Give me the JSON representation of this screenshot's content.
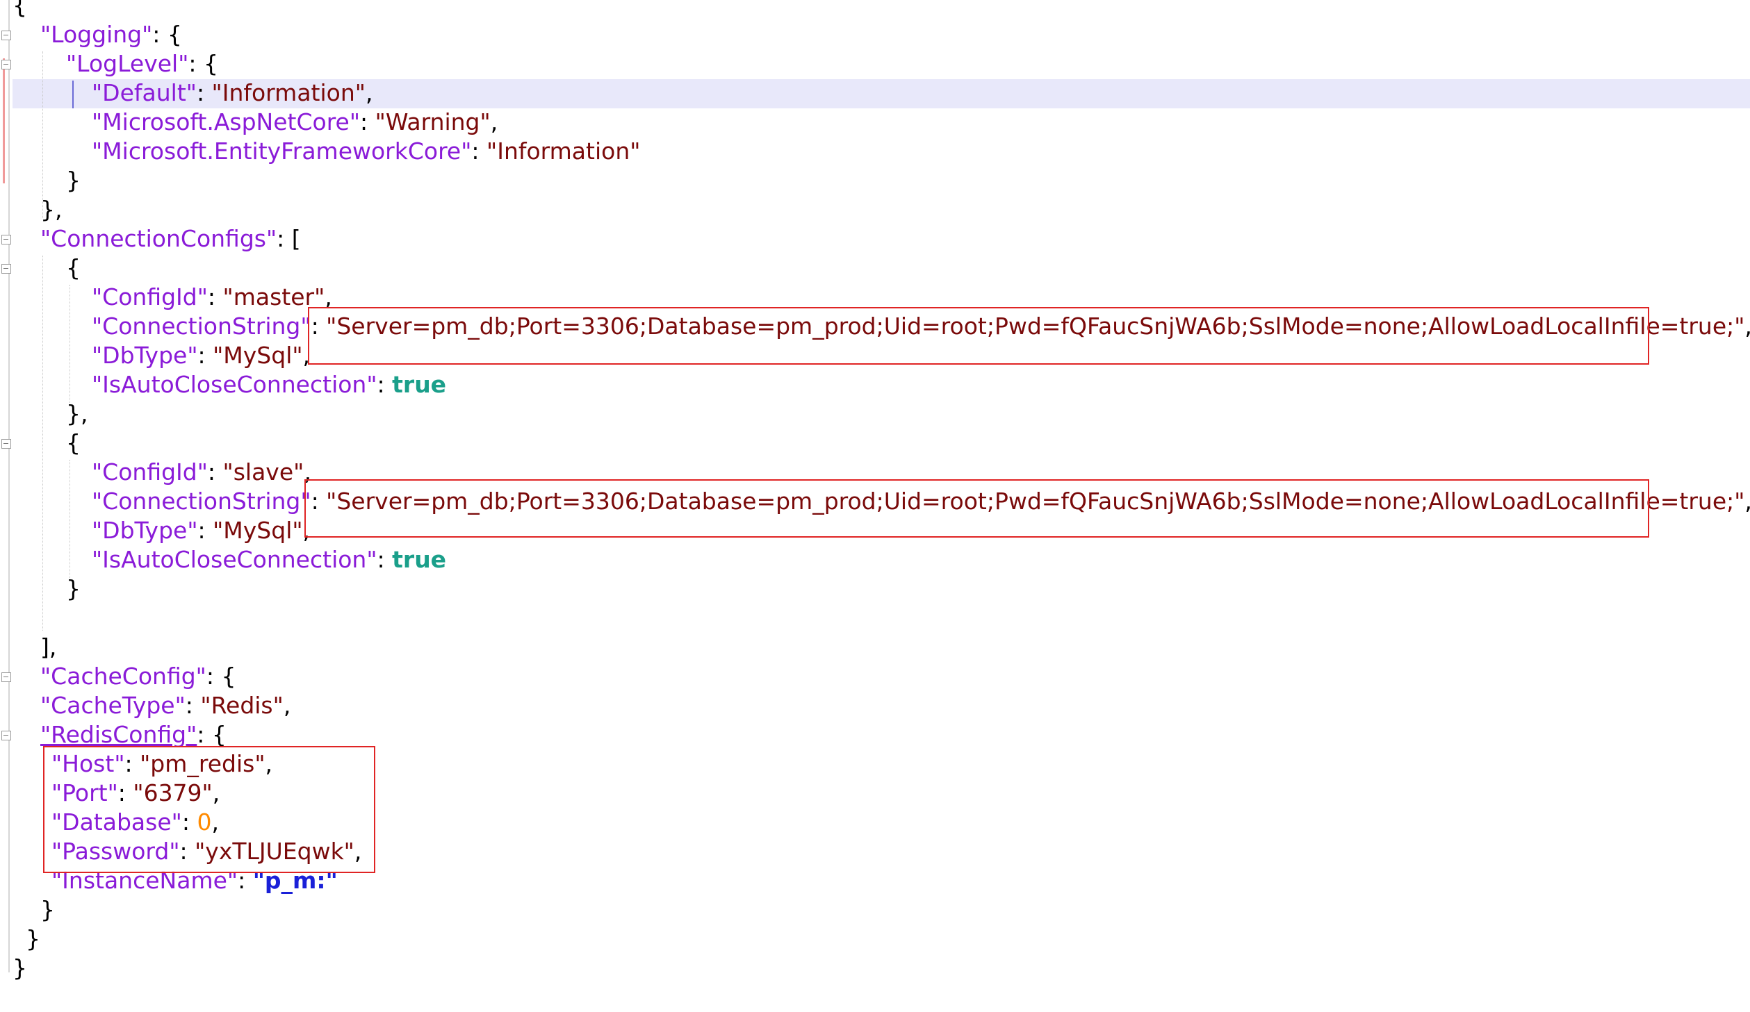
{
  "editor": {
    "lines": [
      {
        "id": "l01",
        "parts": [
          {
            "cls": "p",
            "text": "{"
          }
        ]
      },
      {
        "id": "l02",
        "parts": [
          {
            "cls": "k",
            "text": "\"Logging\""
          },
          {
            "cls": "p",
            "text": ": {"
          }
        ]
      },
      {
        "id": "l03",
        "parts": [
          {
            "cls": "k",
            "text": "\"LogLevel\""
          },
          {
            "cls": "p",
            "text": ": {"
          }
        ]
      },
      {
        "id": "l04",
        "parts": [
          {
            "cls": "k",
            "text": "\"Default\""
          },
          {
            "cls": "p",
            "text": ": "
          },
          {
            "cls": "s",
            "text": "\"Information\""
          },
          {
            "cls": "p",
            "text": ","
          }
        ]
      },
      {
        "id": "l05",
        "parts": [
          {
            "cls": "k",
            "text": "\"Microsoft.AspNetCore\""
          },
          {
            "cls": "p",
            "text": ": "
          },
          {
            "cls": "s",
            "text": "\"Warning\""
          },
          {
            "cls": "p",
            "text": ","
          }
        ]
      },
      {
        "id": "l06",
        "parts": [
          {
            "cls": "k",
            "text": "\"Microsoft.EntityFrameworkCore\""
          },
          {
            "cls": "p",
            "text": ": "
          },
          {
            "cls": "s",
            "text": "\"Information\""
          }
        ]
      },
      {
        "id": "l07",
        "parts": [
          {
            "cls": "p",
            "text": "}"
          }
        ]
      },
      {
        "id": "l08",
        "parts": [
          {
            "cls": "p",
            "text": "},"
          }
        ]
      },
      {
        "id": "l09",
        "parts": [
          {
            "cls": "k",
            "text": "\"ConnectionConfigs\""
          },
          {
            "cls": "p",
            "text": ": ["
          }
        ]
      },
      {
        "id": "l10",
        "parts": [
          {
            "cls": "p",
            "text": "{"
          }
        ]
      },
      {
        "id": "l11",
        "parts": [
          {
            "cls": "k",
            "text": "\"ConfigId\""
          },
          {
            "cls": "p",
            "text": ": "
          },
          {
            "cls": "s",
            "text": "\"master\""
          },
          {
            "cls": "p",
            "text": ","
          }
        ]
      },
      {
        "id": "l12",
        "parts": [
          {
            "cls": "k",
            "text": "\"ConnectionString\""
          },
          {
            "cls": "p",
            "text": ": "
          },
          {
            "cls": "s",
            "text": "\"Server=pm_db;Port=3306;Database=pm_prod;Uid=root;Pwd=fQFaucSnjWA6b;SslMode=none;AllowLoadLocalInfile=true;\""
          },
          {
            "cls": "p",
            "text": ","
          }
        ]
      },
      {
        "id": "l13",
        "parts": [
          {
            "cls": "k",
            "text": "\"DbType\""
          },
          {
            "cls": "p",
            "text": ": "
          },
          {
            "cls": "s",
            "text": "\"MySql\""
          },
          {
            "cls": "p",
            "text": ","
          }
        ]
      },
      {
        "id": "l14",
        "parts": [
          {
            "cls": "k",
            "text": "\"IsAutoCloseConnection\""
          },
          {
            "cls": "p",
            "text": ": "
          },
          {
            "cls": "b",
            "text": "true"
          }
        ]
      },
      {
        "id": "l15",
        "parts": [
          {
            "cls": "p",
            "text": "},"
          }
        ]
      },
      {
        "id": "l16",
        "parts": [
          {
            "cls": "p",
            "text": "{"
          }
        ]
      },
      {
        "id": "l17",
        "parts": [
          {
            "cls": "k",
            "text": "\"ConfigId\""
          },
          {
            "cls": "p",
            "text": ": "
          },
          {
            "cls": "s",
            "text": "\"slave\""
          },
          {
            "cls": "p",
            "text": ","
          }
        ]
      },
      {
        "id": "l18",
        "parts": [
          {
            "cls": "k",
            "text": "\"ConnectionString\""
          },
          {
            "cls": "p",
            "text": ": "
          },
          {
            "cls": "s",
            "text": "\"Server=pm_db;Port=3306;Database=pm_prod;Uid=root;Pwd=fQFaucSnjWA6b;SslMode=none;AllowLoadLocalInfile=true;\""
          },
          {
            "cls": "p",
            "text": ","
          }
        ]
      },
      {
        "id": "l19",
        "parts": [
          {
            "cls": "k",
            "text": "\"DbType\""
          },
          {
            "cls": "p",
            "text": ": "
          },
          {
            "cls": "s",
            "text": "\"MySql\""
          },
          {
            "cls": "p",
            "text": ","
          }
        ]
      },
      {
        "id": "l20",
        "parts": [
          {
            "cls": "k",
            "text": "\"IsAutoCloseConnection\""
          },
          {
            "cls": "p",
            "text": ": "
          },
          {
            "cls": "b",
            "text": "true"
          }
        ]
      },
      {
        "id": "l21",
        "parts": [
          {
            "cls": "p",
            "text": "}"
          }
        ]
      },
      {
        "id": "l22",
        "parts": []
      },
      {
        "id": "l23",
        "parts": [
          {
            "cls": "p",
            "text": "],"
          }
        ]
      },
      {
        "id": "l24",
        "parts": [
          {
            "cls": "k",
            "text": "\"CacheConfig\""
          },
          {
            "cls": "p",
            "text": ": {"
          }
        ]
      },
      {
        "id": "l25",
        "parts": [
          {
            "cls": "k",
            "text": "\"CacheType\""
          },
          {
            "cls": "p",
            "text": ": "
          },
          {
            "cls": "s",
            "text": "\"Redis\""
          },
          {
            "cls": "p",
            "text": ","
          }
        ]
      },
      {
        "id": "l26",
        "parts": [
          {
            "cls": "k u",
            "text": "\"RedisConfig\""
          },
          {
            "cls": "p",
            "text": ": {"
          }
        ]
      },
      {
        "id": "l27",
        "parts": [
          {
            "cls": "k",
            "text": "\"Host\""
          },
          {
            "cls": "p",
            "text": ": "
          },
          {
            "cls": "s",
            "text": "\"pm_redis\""
          },
          {
            "cls": "p",
            "text": ","
          }
        ]
      },
      {
        "id": "l28",
        "parts": [
          {
            "cls": "k",
            "text": "\"Port\""
          },
          {
            "cls": "p",
            "text": ": "
          },
          {
            "cls": "s",
            "text": "\"6379\""
          },
          {
            "cls": "p",
            "text": ","
          }
        ]
      },
      {
        "id": "l29",
        "parts": [
          {
            "cls": "k",
            "text": "\"Database\""
          },
          {
            "cls": "p",
            "text": ": "
          },
          {
            "cls": "n",
            "text": "0"
          },
          {
            "cls": "p",
            "text": ","
          }
        ]
      },
      {
        "id": "l30",
        "parts": [
          {
            "cls": "k",
            "text": "\"Password\""
          },
          {
            "cls": "p",
            "text": ": "
          },
          {
            "cls": "s",
            "text": "\"yxTLJUEqwk\""
          },
          {
            "cls": "p",
            "text": ","
          }
        ]
      },
      {
        "id": "l31",
        "parts": [
          {
            "cls": "k",
            "text": "\"InstanceName\""
          },
          {
            "cls": "p",
            "text": ": "
          },
          {
            "cls": "sb",
            "text": "\"p_m:\""
          }
        ]
      },
      {
        "id": "l32",
        "parts": [
          {
            "cls": "p",
            "text": "}"
          }
        ]
      },
      {
        "id": "l33",
        "parts": [
          {
            "cls": "p",
            "text": "}"
          }
        ]
      },
      {
        "id": "l34",
        "parts": [
          {
            "cls": "p",
            "text": "}"
          }
        ]
      }
    ],
    "annotations": [
      {
        "name": "highlight-master-connection-string",
        "target": "l12"
      },
      {
        "name": "highlight-slave-connection-string",
        "target": "l18"
      },
      {
        "name": "highlight-redis-credentials",
        "target": "l27-l30"
      }
    ],
    "colors": {
      "key": "#8a1bd8",
      "string": "#7a0a0a",
      "boolean": "#1a9f8a",
      "number": "#ff8a00",
      "bold_string": "#1a20d8",
      "highlight_box": "#e02424",
      "current_line": "#e8e8fa"
    }
  }
}
